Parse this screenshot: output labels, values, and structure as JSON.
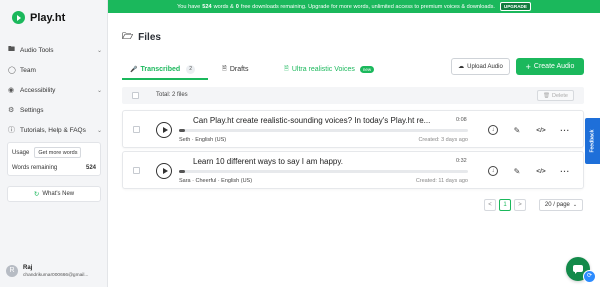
{
  "app": {
    "name": "Play.ht"
  },
  "banner": {
    "pre": "You have",
    "words": "524",
    "mid": "words &",
    "downloads": "0",
    "post": "free downloads remaining. Upgrade for more words, unlimited access to premium voices & downloads.",
    "upgrade_label": "UPGRADE",
    "color": "#1bb85c"
  },
  "sidebar": {
    "items": [
      {
        "label": "Audio Tools",
        "icon": "folder-icon",
        "chevron": true
      },
      {
        "label": "Team",
        "icon": "people-icon",
        "chevron": false
      },
      {
        "label": "Accessibility",
        "icon": "eye-icon",
        "chevron": true
      },
      {
        "label": "Settings",
        "icon": "gear-icon",
        "chevron": false
      },
      {
        "label": "Tutorials, Help & FAQs",
        "icon": "help-icon",
        "chevron": true
      }
    ],
    "usage": {
      "label": "Usage",
      "more_words_label": "Get more words",
      "remaining_label": "Words remaining",
      "remaining_value": "524"
    },
    "whats_new_label": "What's New",
    "profile": {
      "initial": "R",
      "name": "Raj",
      "email": "chandrikumar000666@gmail..."
    }
  },
  "main": {
    "title": "Files",
    "tabs": [
      {
        "label": "Transcribed",
        "count": "2",
        "active": true
      },
      {
        "label": "Drafts",
        "active": false
      },
      {
        "label": "Ultra realistic Voices",
        "badge": "new",
        "active": false
      }
    ],
    "upload_label": "Upload Audio",
    "create_label": "Create Audio",
    "total_label": "Total: 2 files",
    "delete_label": "Delete",
    "files": [
      {
        "title": "Can Play.ht create realistic-sounding voices? In today's Play.ht re...",
        "duration": "0:08",
        "voice": "Seth · English (US)",
        "created": "Created: 3 days ago",
        "progress": 0.02
      },
      {
        "title": "Learn 10 different ways to say I am happy.",
        "duration": "0:32",
        "voice": "Sara · Cheerful · English (US)",
        "created": "Created: 11 days ago",
        "progress": 0.02
      }
    ],
    "pagination": {
      "prev": "<",
      "current": "1",
      "next": ">",
      "page_size": "20 / page"
    }
  },
  "feedback_label": "Feedback",
  "accent_color": "#1bb85c"
}
